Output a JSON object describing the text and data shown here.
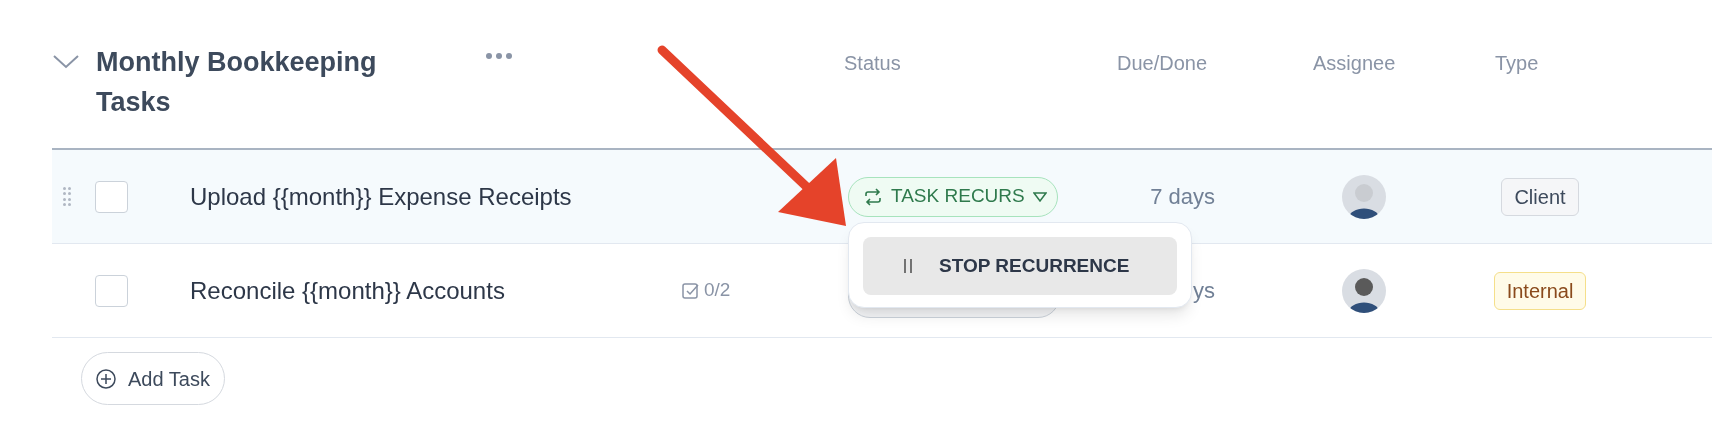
{
  "section": {
    "title": "Monthly Bookkeeping Tasks",
    "expanded": true
  },
  "columns": [
    "Status",
    "Due/Done",
    "Assignee",
    "Type"
  ],
  "tasks": [
    {
      "title": "Upload {{month}} Expense Receipts",
      "checked": false,
      "selected": true,
      "status": {
        "kind": "recurring",
        "label": "TASK RECURS"
      },
      "due": "7 days",
      "type": {
        "kind": "client",
        "label": "Client"
      }
    },
    {
      "title": "Reconcile {{month}} Accounts",
      "checked": false,
      "selected": false,
      "subtasks": "0/2",
      "status": {
        "kind": "covered"
      },
      "due": "ys",
      "type": {
        "kind": "internal",
        "label": "Internal"
      }
    }
  ],
  "status_menu": {
    "items": [
      {
        "label": "STOP RECURRENCE"
      }
    ]
  },
  "add_button": "Add Task"
}
